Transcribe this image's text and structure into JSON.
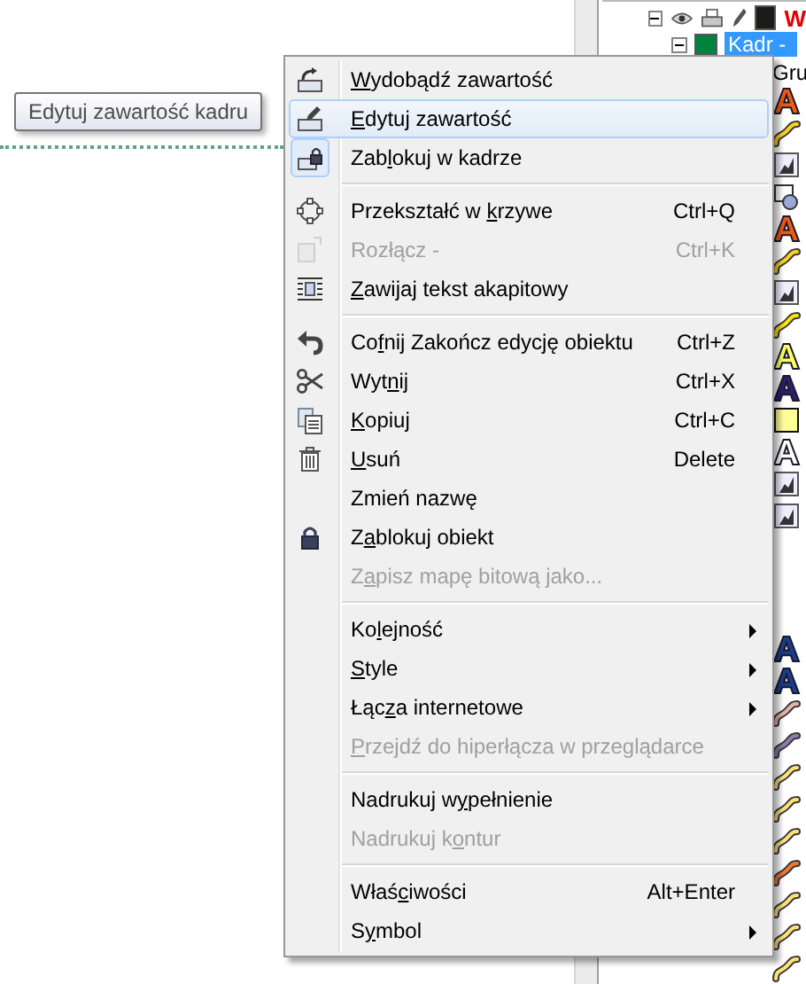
{
  "tooltip": {
    "text": "Edytuj zawartość kadru"
  },
  "object_manager": {
    "layer": {
      "name": "W",
      "color": "#1e1a18"
    },
    "frame": {
      "name": "Kadr -",
      "color": "#00843d",
      "selected": true
    },
    "group_label": "Gru",
    "objects_upper": [
      {
        "kind": "text",
        "color": "#f05a14"
      },
      {
        "kind": "curve",
        "color": "#ffd21e"
      },
      {
        "kind": "bitmap"
      },
      {
        "kind": "group"
      },
      {
        "kind": "text",
        "color": "#f05a14"
      },
      {
        "kind": "curve",
        "color": "#ffd21e"
      },
      {
        "kind": "bitmap"
      },
      {
        "kind": "curve",
        "color": "#ffe600"
      },
      {
        "kind": "text",
        "color": "#ffff66"
      },
      {
        "kind": "text",
        "color": "#2c1f6e"
      },
      {
        "kind": "rectangle",
        "color": "#ffff99"
      },
      {
        "kind": "text",
        "color": "#ffffff"
      },
      {
        "kind": "bitmap"
      },
      {
        "kind": "bitmap"
      }
    ],
    "objects_lower": [
      {
        "kind": "text",
        "color": "#1c3c8c"
      },
      {
        "kind": "text",
        "color": "#1c3c8c"
      },
      {
        "kind": "curve",
        "color": "#e8b4aa"
      },
      {
        "kind": "curve",
        "color": "#8c7eaa"
      },
      {
        "kind": "curve",
        "color": "#ffe27a"
      },
      {
        "kind": "curve",
        "color": "#ffe27a"
      },
      {
        "kind": "curve",
        "color": "#ffe27a"
      },
      {
        "kind": "curve",
        "color": "#f07832"
      },
      {
        "kind": "curve",
        "color": "#ffe27a"
      },
      {
        "kind": "curve",
        "color": "#ffe27a"
      },
      {
        "kind": "curve",
        "color": "#ffe27a"
      }
    ]
  },
  "context_menu": {
    "items": [
      {
        "kind": "item",
        "label": [
          {
            "text": "W",
            "underlined": true
          },
          {
            "text": "ydobądź zawartość",
            "underlined": false
          }
        ],
        "selected": false,
        "disabled": false,
        "checked": false,
        "submenu": false
      },
      {
        "kind": "item",
        "label": [
          {
            "text": "E",
            "underlined": true
          },
          {
            "text": "dytuj zawartość",
            "underlined": false
          }
        ],
        "selected": true,
        "disabled": false,
        "checked": false,
        "submenu": false
      },
      {
        "kind": "item",
        "label": [
          {
            "text": "Zab",
            "underlined": false
          },
          {
            "text": "l",
            "underlined": true
          },
          {
            "text": "okuj w kadrze",
            "underlined": false
          }
        ],
        "selected": false,
        "disabled": false,
        "checked": true,
        "submenu": false
      },
      {
        "kind": "separator"
      },
      {
        "kind": "item",
        "label": [
          {
            "text": "Przekształć w ",
            "underlined": false
          },
          {
            "text": "k",
            "underlined": true
          },
          {
            "text": "rzywe",
            "underlined": false
          }
        ],
        "shortcut": "Ctrl+Q",
        "selected": false,
        "disabled": false,
        "checked": false,
        "submenu": false
      },
      {
        "kind": "item",
        "label": [
          {
            "text": "Rozłącz -",
            "underlined": false
          }
        ],
        "shortcut": "Ctrl+K",
        "selected": false,
        "disabled": true,
        "checked": false,
        "submenu": false
      },
      {
        "kind": "item",
        "label": [
          {
            "text": "Z",
            "underlined": true
          },
          {
            "text": "awijaj tekst akapitowy",
            "underlined": false
          }
        ],
        "selected": false,
        "disabled": false,
        "checked": false,
        "submenu": false
      },
      {
        "kind": "separator"
      },
      {
        "kind": "item",
        "label": [
          {
            "text": "Co",
            "underlined": false
          },
          {
            "text": "f",
            "underlined": true
          },
          {
            "text": "nij Zakończ edycję obiektu",
            "underlined": false
          }
        ],
        "shortcut": "Ctrl+Z",
        "selected": false,
        "disabled": false,
        "checked": false,
        "submenu": false
      },
      {
        "kind": "item",
        "label": [
          {
            "text": "Wyt",
            "underlined": false
          },
          {
            "text": "n",
            "underlined": true
          },
          {
            "text": "ij",
            "underlined": false
          }
        ],
        "shortcut": "Ctrl+X",
        "selected": false,
        "disabled": false,
        "checked": false,
        "submenu": false
      },
      {
        "kind": "item",
        "label": [
          {
            "text": "K",
            "underlined": true
          },
          {
            "text": "opiuj",
            "underlined": false
          }
        ],
        "shortcut": "Ctrl+C",
        "selected": false,
        "disabled": false,
        "checked": false,
        "submenu": false
      },
      {
        "kind": "item",
        "label": [
          {
            "text": "U",
            "underlined": true
          },
          {
            "text": "suń",
            "underlined": false
          }
        ],
        "shortcut": "Delete",
        "selected": false,
        "disabled": false,
        "checked": false,
        "submenu": false
      },
      {
        "kind": "item",
        "label": [
          {
            "text": "Zmień nazwę",
            "underlined": false
          }
        ],
        "selected": false,
        "disabled": false,
        "checked": false,
        "submenu": false
      },
      {
        "kind": "item",
        "label": [
          {
            "text": "Z",
            "underlined": false
          },
          {
            "text": "a",
            "underlined": true
          },
          {
            "text": "blokuj obiekt",
            "underlined": false
          }
        ],
        "selected": false,
        "disabled": false,
        "checked": false,
        "submenu": false
      },
      {
        "kind": "item",
        "label": [
          {
            "text": "Z",
            "underlined": false
          },
          {
            "text": "a",
            "underlined": true
          },
          {
            "text": "pisz mapę bitową jako...",
            "underlined": false
          }
        ],
        "selected": false,
        "disabled": true,
        "checked": false,
        "submenu": false
      },
      {
        "kind": "separator"
      },
      {
        "kind": "item",
        "label": [
          {
            "text": "Ko",
            "underlined": false
          },
          {
            "text": "l",
            "underlined": true
          },
          {
            "text": "ejność",
            "underlined": false
          }
        ],
        "selected": false,
        "disabled": false,
        "checked": false,
        "submenu": true
      },
      {
        "kind": "item",
        "label": [
          {
            "text": "S",
            "underlined": true
          },
          {
            "text": "tyle",
            "underlined": false
          }
        ],
        "selected": false,
        "disabled": false,
        "checked": false,
        "submenu": true
      },
      {
        "kind": "item",
        "label": [
          {
            "text": "Łą",
            "underlined": false
          },
          {
            "text": "c",
            "underlined": false
          },
          {
            "text": "z",
            "underlined": true
          },
          {
            "text": "a internetowe",
            "underlined": false
          }
        ],
        "selected": false,
        "disabled": false,
        "checked": false,
        "submenu": true
      },
      {
        "kind": "item",
        "label": [
          {
            "text": "P",
            "underlined": true
          },
          {
            "text": "rzejdź do hiperłącza w przeglądarce",
            "underlined": false
          }
        ],
        "selected": false,
        "disabled": true,
        "checked": false,
        "submenu": false
      },
      {
        "kind": "separator"
      },
      {
        "kind": "item",
        "label": [
          {
            "text": "Nadrukuj w",
            "underlined": false
          },
          {
            "text": "y",
            "underlined": true
          },
          {
            "text": "pełnienie",
            "underlined": false
          }
        ],
        "selected": false,
        "disabled": false,
        "checked": false,
        "submenu": false
      },
      {
        "kind": "item",
        "label": [
          {
            "text": "Nadrukuj k",
            "underlined": false
          },
          {
            "text": "o",
            "underlined": true
          },
          {
            "text": "ntur",
            "underlined": false
          }
        ],
        "selected": false,
        "disabled": true,
        "checked": false,
        "submenu": false
      },
      {
        "kind": "separator"
      },
      {
        "kind": "item",
        "label": [
          {
            "text": "Właś",
            "underlined": false
          },
          {
            "text": "c",
            "underlined": true
          },
          {
            "text": "iwości",
            "underlined": false
          }
        ],
        "shortcut": "Alt+Enter",
        "selected": false,
        "disabled": false,
        "checked": false,
        "submenu": false
      },
      {
        "kind": "item",
        "label": [
          {
            "text": "S",
            "underlined": false
          },
          {
            "text": "y",
            "underlined": true
          },
          {
            "text": "mbol",
            "underlined": false
          }
        ],
        "selected": false,
        "disabled": false,
        "checked": false,
        "submenu": true
      }
    ]
  }
}
